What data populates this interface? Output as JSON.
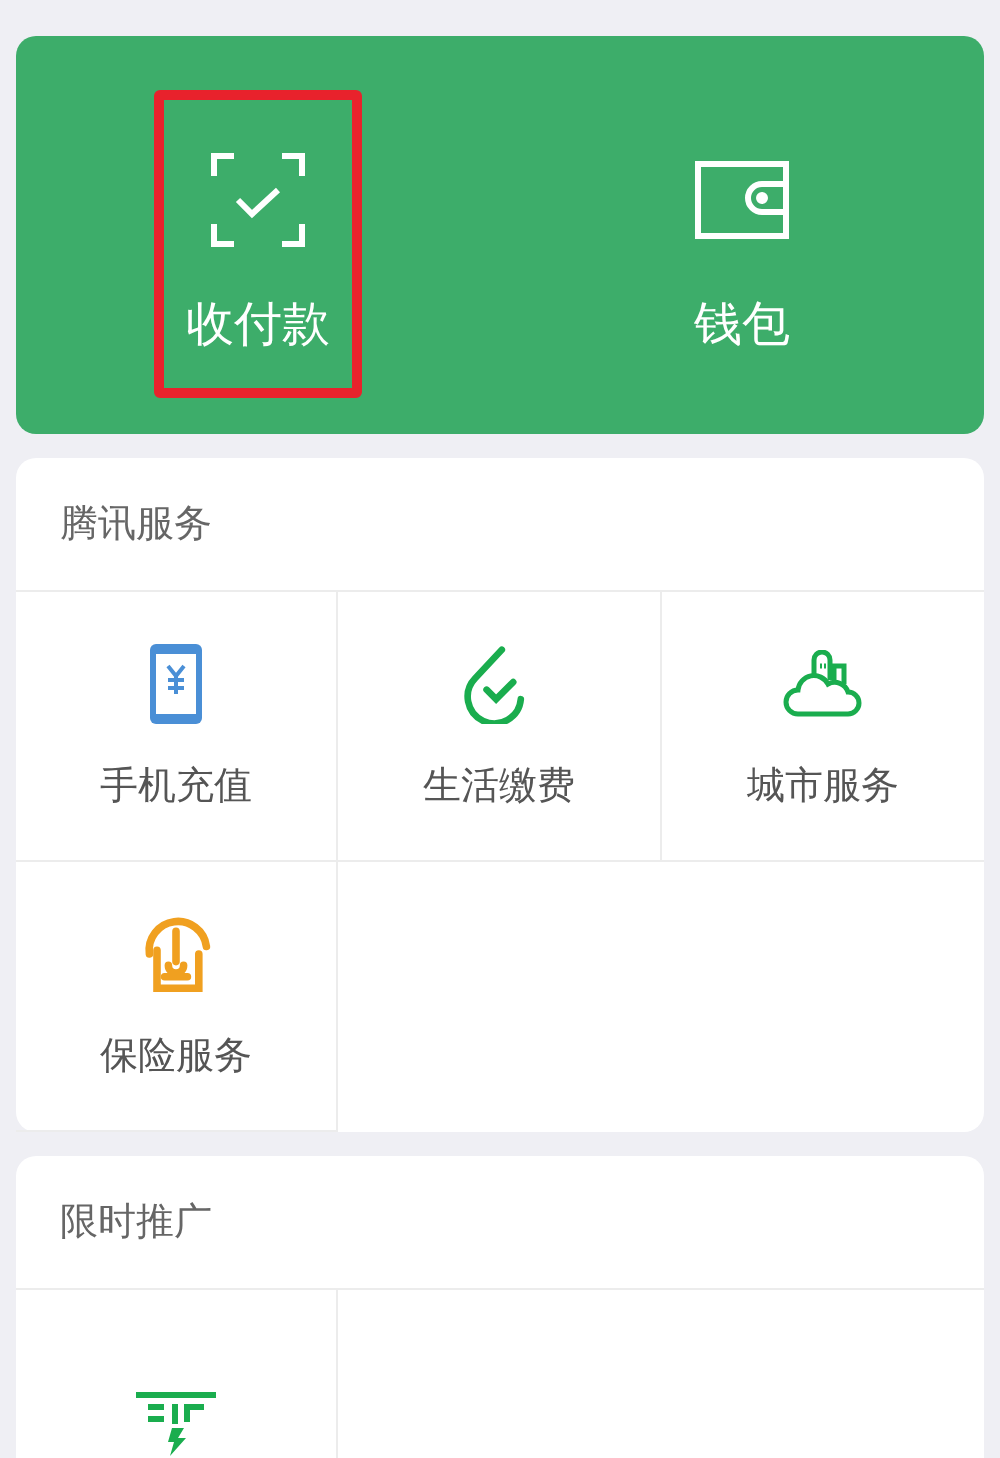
{
  "wallet_actions": [
    {
      "label": "收付款",
      "highlighted": true
    },
    {
      "label": "钱包",
      "highlighted": false
    }
  ],
  "sections": [
    {
      "title": "腾讯服务",
      "items": [
        {
          "label": "手机充值"
        },
        {
          "label": "生活缴费"
        },
        {
          "label": "城市服务"
        },
        {
          "label": "保险服务"
        }
      ]
    },
    {
      "title": "限时推广"
    }
  ]
}
